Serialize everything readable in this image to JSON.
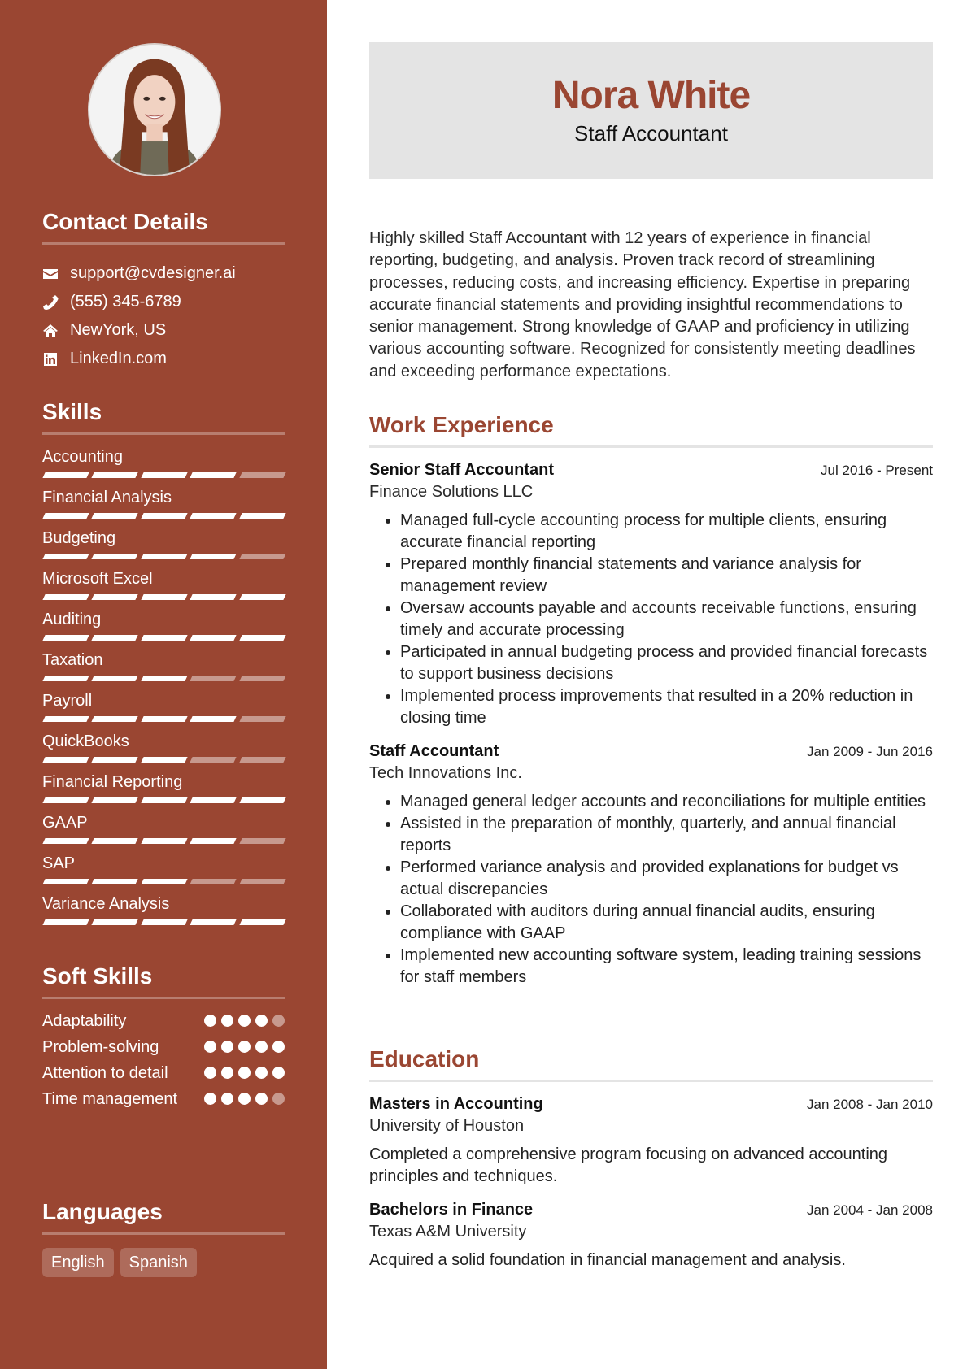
{
  "colors": {
    "accent": "#9a4632",
    "header_bg": "#e4e4e4"
  },
  "profile": {
    "name": "Nora White",
    "title": "Staff Accountant",
    "photo_alt": "profile-photo"
  },
  "contact": {
    "heading": "Contact Details",
    "items": [
      {
        "icon": "envelope-icon",
        "text": "support@cvdesigner.ai"
      },
      {
        "icon": "phone-icon",
        "text": "(555) 345-6789"
      },
      {
        "icon": "home-icon",
        "text": "NewYork, US"
      },
      {
        "icon": "linkedin-icon",
        "text": "LinkedIn.com"
      }
    ]
  },
  "skills": {
    "heading": "Skills",
    "max": 5,
    "items": [
      {
        "name": "Accounting",
        "level": 4
      },
      {
        "name": "Financial Analysis",
        "level": 5
      },
      {
        "name": "Budgeting",
        "level": 4
      },
      {
        "name": "Microsoft Excel",
        "level": 5
      },
      {
        "name": "Auditing",
        "level": 5
      },
      {
        "name": "Taxation",
        "level": 3
      },
      {
        "name": "Payroll",
        "level": 4
      },
      {
        "name": "QuickBooks",
        "level": 3
      },
      {
        "name": "Financial Reporting",
        "level": 5
      },
      {
        "name": "GAAP",
        "level": 4
      },
      {
        "name": "SAP",
        "level": 3
      },
      {
        "name": "Variance Analysis",
        "level": 5
      }
    ]
  },
  "soft_skills": {
    "heading": "Soft Skills",
    "max": 5,
    "items": [
      {
        "name": "Adaptability",
        "level": 4
      },
      {
        "name": "Problem-solving",
        "level": 5
      },
      {
        "name": "Attention to detail",
        "level": 5
      },
      {
        "name": "Time management",
        "level": 4
      }
    ]
  },
  "languages": {
    "heading": "Languages",
    "items": [
      "English",
      "Spanish"
    ]
  },
  "summary": "Highly skilled Staff Accountant with 12 years of experience in financial reporting, budgeting, and analysis. Proven track record of streamlining processes, reducing costs, and increasing efficiency. Expertise in preparing accurate financial statements and providing insightful recommendations to senior management. Strong knowledge of GAAP and proficiency in utilizing various accounting software. Recognized for consistently meeting deadlines and exceeding performance expectations.",
  "experience": {
    "heading": "Work Experience",
    "items": [
      {
        "title": "Senior Staff Accountant",
        "company": "Finance Solutions LLC",
        "dates": "Jul 2016 - Present",
        "bullets": [
          "Managed full-cycle accounting process for multiple clients, ensuring accurate financial reporting",
          "Prepared monthly financial statements and variance analysis for management review",
          "Oversaw accounts payable and accounts receivable functions, ensuring timely and accurate processing",
          "Participated in annual budgeting process and provided financial forecasts to support business decisions",
          "Implemented process improvements that resulted in a 20% reduction in closing time"
        ]
      },
      {
        "title": "Staff Accountant",
        "company": "Tech Innovations Inc.",
        "dates": "Jan 2009 - Jun 2016",
        "bullets": [
          "Managed general ledger accounts and reconciliations for multiple entities",
          "Assisted in the preparation of monthly, quarterly, and annual financial reports",
          "Performed variance analysis and provided explanations for budget vs actual discrepancies",
          "Collaborated with auditors during annual financial audits, ensuring compliance with GAAP",
          "Implemented new accounting software system, leading training sessions for staff members"
        ]
      }
    ]
  },
  "education": {
    "heading": "Education",
    "items": [
      {
        "degree": "Masters in Accounting",
        "school": "University of Houston",
        "dates": "Jan 2008 - Jan 2010",
        "description": "Completed a comprehensive program focusing on advanced accounting principles and techniques."
      },
      {
        "degree": "Bachelors in Finance",
        "school": "Texas A&M University",
        "dates": "Jan 2004 - Jan 2008",
        "description": "Acquired a solid foundation in financial management and analysis."
      }
    ]
  }
}
